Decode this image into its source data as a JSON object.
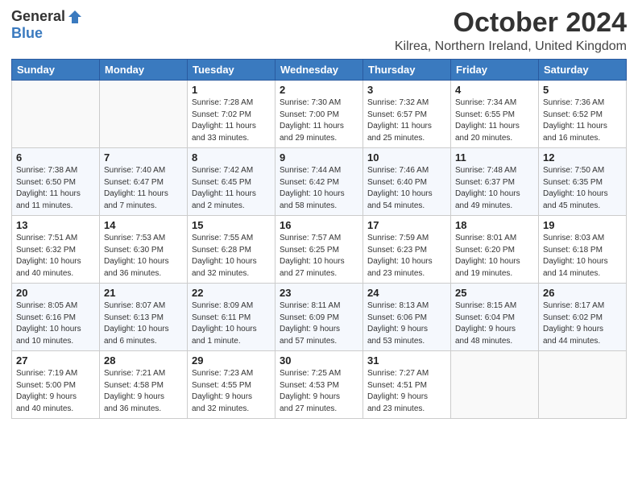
{
  "header": {
    "logo_general": "General",
    "logo_blue": "Blue",
    "month_title": "October 2024",
    "location": "Kilrea, Northern Ireland, United Kingdom"
  },
  "days_of_week": [
    "Sunday",
    "Monday",
    "Tuesday",
    "Wednesday",
    "Thursday",
    "Friday",
    "Saturday"
  ],
  "weeks": [
    [
      {
        "day": "",
        "info": ""
      },
      {
        "day": "",
        "info": ""
      },
      {
        "day": "1",
        "info": "Sunrise: 7:28 AM\nSunset: 7:02 PM\nDaylight: 11 hours\nand 33 minutes."
      },
      {
        "day": "2",
        "info": "Sunrise: 7:30 AM\nSunset: 7:00 PM\nDaylight: 11 hours\nand 29 minutes."
      },
      {
        "day": "3",
        "info": "Sunrise: 7:32 AM\nSunset: 6:57 PM\nDaylight: 11 hours\nand 25 minutes."
      },
      {
        "day": "4",
        "info": "Sunrise: 7:34 AM\nSunset: 6:55 PM\nDaylight: 11 hours\nand 20 minutes."
      },
      {
        "day": "5",
        "info": "Sunrise: 7:36 AM\nSunset: 6:52 PM\nDaylight: 11 hours\nand 16 minutes."
      }
    ],
    [
      {
        "day": "6",
        "info": "Sunrise: 7:38 AM\nSunset: 6:50 PM\nDaylight: 11 hours\nand 11 minutes."
      },
      {
        "day": "7",
        "info": "Sunrise: 7:40 AM\nSunset: 6:47 PM\nDaylight: 11 hours\nand 7 minutes."
      },
      {
        "day": "8",
        "info": "Sunrise: 7:42 AM\nSunset: 6:45 PM\nDaylight: 11 hours\nand 2 minutes."
      },
      {
        "day": "9",
        "info": "Sunrise: 7:44 AM\nSunset: 6:42 PM\nDaylight: 10 hours\nand 58 minutes."
      },
      {
        "day": "10",
        "info": "Sunrise: 7:46 AM\nSunset: 6:40 PM\nDaylight: 10 hours\nand 54 minutes."
      },
      {
        "day": "11",
        "info": "Sunrise: 7:48 AM\nSunset: 6:37 PM\nDaylight: 10 hours\nand 49 minutes."
      },
      {
        "day": "12",
        "info": "Sunrise: 7:50 AM\nSunset: 6:35 PM\nDaylight: 10 hours\nand 45 minutes."
      }
    ],
    [
      {
        "day": "13",
        "info": "Sunrise: 7:51 AM\nSunset: 6:32 PM\nDaylight: 10 hours\nand 40 minutes."
      },
      {
        "day": "14",
        "info": "Sunrise: 7:53 AM\nSunset: 6:30 PM\nDaylight: 10 hours\nand 36 minutes."
      },
      {
        "day": "15",
        "info": "Sunrise: 7:55 AM\nSunset: 6:28 PM\nDaylight: 10 hours\nand 32 minutes."
      },
      {
        "day": "16",
        "info": "Sunrise: 7:57 AM\nSunset: 6:25 PM\nDaylight: 10 hours\nand 27 minutes."
      },
      {
        "day": "17",
        "info": "Sunrise: 7:59 AM\nSunset: 6:23 PM\nDaylight: 10 hours\nand 23 minutes."
      },
      {
        "day": "18",
        "info": "Sunrise: 8:01 AM\nSunset: 6:20 PM\nDaylight: 10 hours\nand 19 minutes."
      },
      {
        "day": "19",
        "info": "Sunrise: 8:03 AM\nSunset: 6:18 PM\nDaylight: 10 hours\nand 14 minutes."
      }
    ],
    [
      {
        "day": "20",
        "info": "Sunrise: 8:05 AM\nSunset: 6:16 PM\nDaylight: 10 hours\nand 10 minutes."
      },
      {
        "day": "21",
        "info": "Sunrise: 8:07 AM\nSunset: 6:13 PM\nDaylight: 10 hours\nand 6 minutes."
      },
      {
        "day": "22",
        "info": "Sunrise: 8:09 AM\nSunset: 6:11 PM\nDaylight: 10 hours\nand 1 minute."
      },
      {
        "day": "23",
        "info": "Sunrise: 8:11 AM\nSunset: 6:09 PM\nDaylight: 9 hours\nand 57 minutes."
      },
      {
        "day": "24",
        "info": "Sunrise: 8:13 AM\nSunset: 6:06 PM\nDaylight: 9 hours\nand 53 minutes."
      },
      {
        "day": "25",
        "info": "Sunrise: 8:15 AM\nSunset: 6:04 PM\nDaylight: 9 hours\nand 48 minutes."
      },
      {
        "day": "26",
        "info": "Sunrise: 8:17 AM\nSunset: 6:02 PM\nDaylight: 9 hours\nand 44 minutes."
      }
    ],
    [
      {
        "day": "27",
        "info": "Sunrise: 7:19 AM\nSunset: 5:00 PM\nDaylight: 9 hours\nand 40 minutes."
      },
      {
        "day": "28",
        "info": "Sunrise: 7:21 AM\nSunset: 4:58 PM\nDaylight: 9 hours\nand 36 minutes."
      },
      {
        "day": "29",
        "info": "Sunrise: 7:23 AM\nSunset: 4:55 PM\nDaylight: 9 hours\nand 32 minutes."
      },
      {
        "day": "30",
        "info": "Sunrise: 7:25 AM\nSunset: 4:53 PM\nDaylight: 9 hours\nand 27 minutes."
      },
      {
        "day": "31",
        "info": "Sunrise: 7:27 AM\nSunset: 4:51 PM\nDaylight: 9 hours\nand 23 minutes."
      },
      {
        "day": "",
        "info": ""
      },
      {
        "day": "",
        "info": ""
      }
    ]
  ]
}
